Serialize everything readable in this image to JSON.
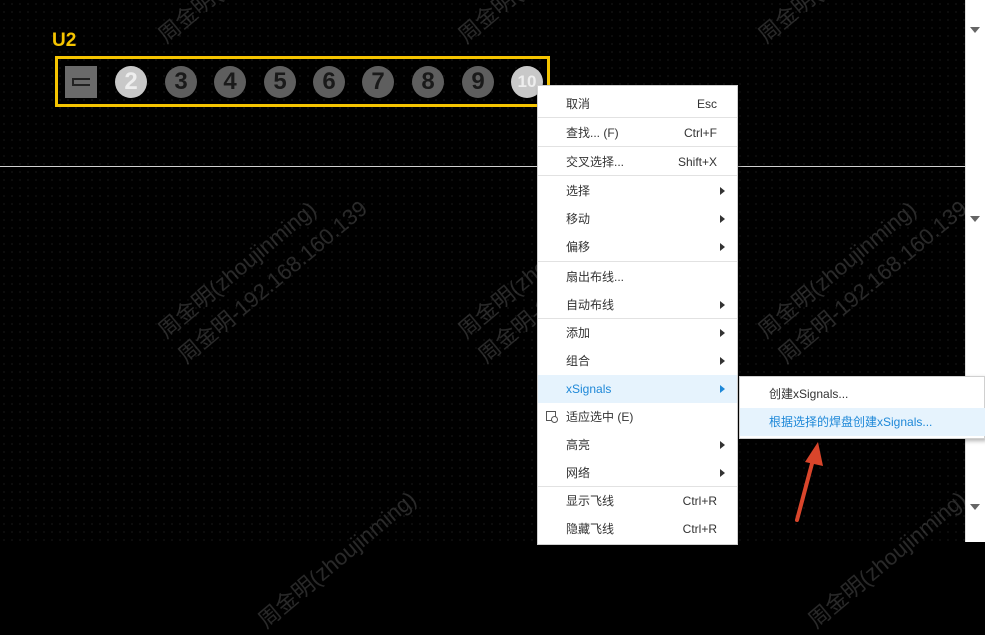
{
  "component": {
    "ref": "U2",
    "pins": [
      "",
      "2",
      "3",
      "4",
      "5",
      "6",
      "7",
      "8",
      "9",
      "10"
    ]
  },
  "watermark": {
    "lines": [
      "周金明(zhoujinming)",
      "周金明-192.168.160.139"
    ]
  },
  "context_menu": {
    "items": [
      {
        "label": "取消",
        "shortcut": "Esc"
      },
      {
        "label": "查找... (F)",
        "shortcut": "Ctrl+F"
      },
      {
        "label": "交叉选择...",
        "shortcut": "Shift+X"
      },
      {
        "label": "选择",
        "shortcut": ""
      },
      {
        "label": "移动",
        "shortcut": ""
      },
      {
        "label": "偏移",
        "shortcut": ""
      },
      {
        "label": "扇出布线...",
        "shortcut": ""
      },
      {
        "label": "自动布线",
        "shortcut": ""
      },
      {
        "label": "添加",
        "shortcut": ""
      },
      {
        "label": "组合",
        "shortcut": ""
      },
      {
        "label": "xSignals",
        "shortcut": ""
      },
      {
        "label": "适应选中 (E)",
        "shortcut": ""
      },
      {
        "label": "高亮",
        "shortcut": ""
      },
      {
        "label": "网络",
        "shortcut": ""
      },
      {
        "label": "显示飞线",
        "shortcut": "Ctrl+R"
      },
      {
        "label": "隐藏飞线",
        "shortcut": "Ctrl+R"
      }
    ]
  },
  "submenu": {
    "items": [
      {
        "label": "创建xSignals..."
      },
      {
        "label": "根据选择的焊盘创建xSignals..."
      }
    ]
  },
  "colors": {
    "component_highlight": "#f5c400",
    "menu_highlight_bg": "#e6f3fd",
    "menu_highlight_text": "#1e88d8",
    "arrow": "#d9452b"
  }
}
